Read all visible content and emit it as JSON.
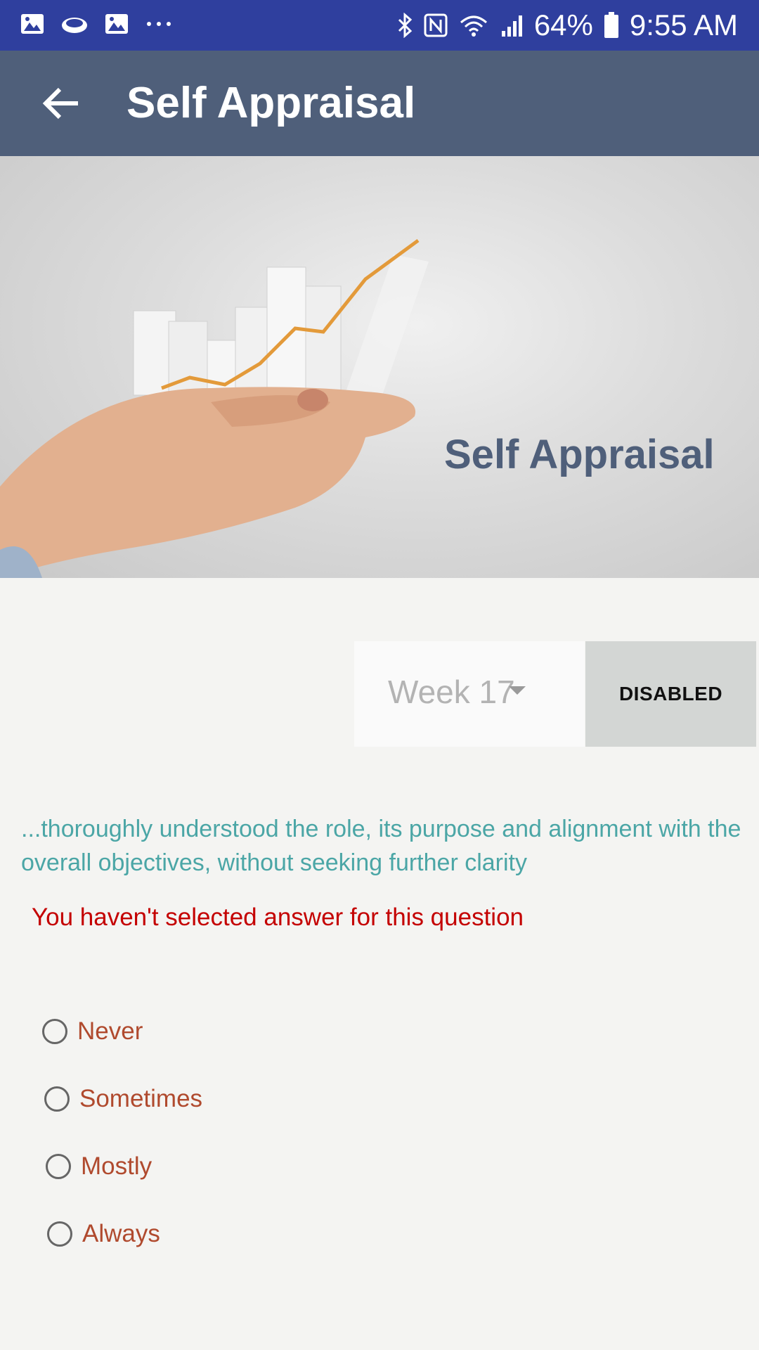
{
  "status_bar": {
    "battery": "64%",
    "time": "9:55 AM",
    "icons": [
      "gallery-icon",
      "cloud-icon",
      "gallery-icon",
      "more-dots-icon",
      "bluetooth-icon",
      "nfc-icon",
      "wifi-icon",
      "signal-icon",
      "battery-icon"
    ]
  },
  "app_bar": {
    "title": "Self Appraisal"
  },
  "banner": {
    "title": "Self Appraisal"
  },
  "controls": {
    "week_value": "Week 17",
    "disabled_label": "DISABLED"
  },
  "question": {
    "text": "...thoroughly understood the role, its purpose and alignment with the overall objectives, without seeking further clarity",
    "error": "You haven't selected answer for this question"
  },
  "options": [
    "Never",
    "Sometimes",
    "Mostly",
    "Always"
  ],
  "colors": {
    "status_bar": "#2f3f9e",
    "app_bar": "#4f5f7a",
    "question": "#4ba6a6",
    "error": "#c40000",
    "option_label": "#b04a2e"
  }
}
